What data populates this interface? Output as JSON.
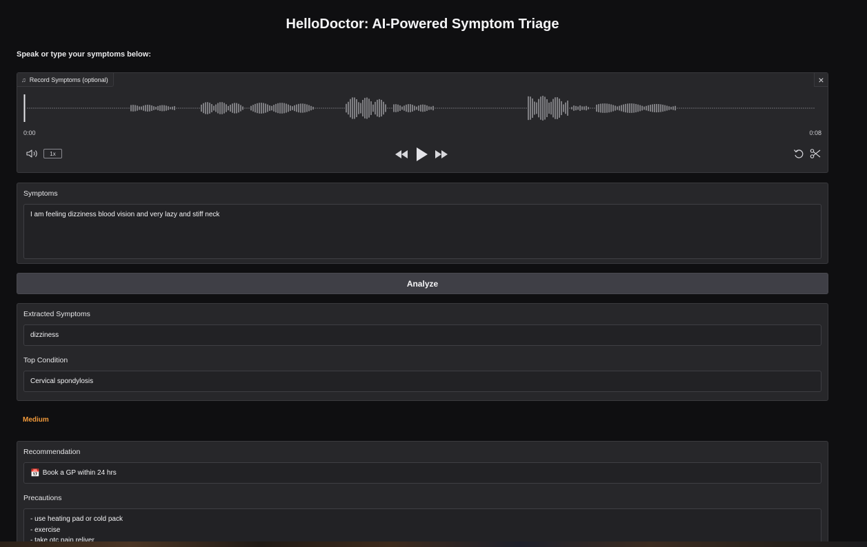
{
  "page": {
    "title": "HelloDoctor: AI-Powered Symptom Triage",
    "instructions": "Speak or type your symptoms below:"
  },
  "audio": {
    "label": "Record Symptoms (optional)",
    "note_icon": "music-note-icon",
    "close_symbol": "×",
    "time_start": "0:00",
    "time_end": "0:08",
    "speed": "1x"
  },
  "symptoms": {
    "label": "Symptoms",
    "value": "I am feeling dizziness blood vision and very lazy and stiff neck"
  },
  "analyze": {
    "label": "Analyze"
  },
  "results": {
    "extracted_label": "Extracted Symptoms",
    "extracted_value": "dizziness",
    "condition_label": "Top Condition",
    "condition_value": "Cervical spondylosis"
  },
  "severity": {
    "text": "Medium",
    "color": "#f0993a"
  },
  "recommendation": {
    "label": "Recommendation",
    "icon": "📅",
    "value": "Book a GP within 24 hrs",
    "precautions_label": "Precautions",
    "precautions": [
      "- use heating pad or cold pack",
      "- exercise",
      "- take otc pain reliver"
    ]
  },
  "colors": {
    "background": "#0f0f11",
    "panel": "#27272a",
    "button": "#3f3f46",
    "accent": "#f0993a"
  }
}
